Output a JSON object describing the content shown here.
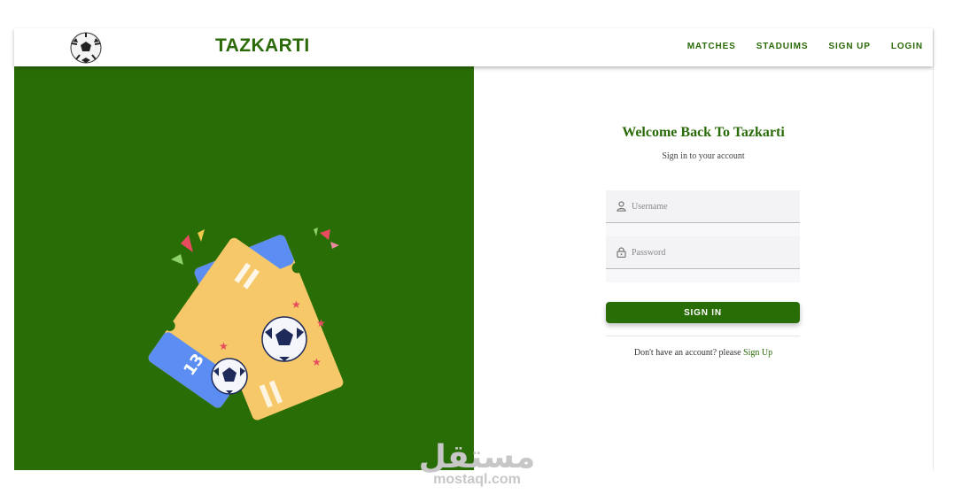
{
  "header": {
    "brand": "TAZKARTI",
    "logo_icon": "soccer-ball-icon",
    "nav": [
      {
        "label": "MATCHES"
      },
      {
        "label": "STADUIMS"
      },
      {
        "label": "SIGN UP"
      },
      {
        "label": "LOGIN"
      }
    ]
  },
  "hero": {
    "ticket_front_number": "13",
    "ticket_back_number": "12",
    "background_color": "#296d06"
  },
  "login": {
    "title": "Welcome Back To Tazkarti",
    "subtitle": "Sign in to your account",
    "username_placeholder": "Username",
    "username_value": "",
    "password_placeholder": "Password",
    "password_value": "",
    "submit_label": "SIGN IN",
    "signup_prompt": "Don't have an account? please",
    "signup_link": "Sign Up"
  },
  "watermark": {
    "arabic": "مستقل",
    "latin": "mostaql.com"
  },
  "colors": {
    "accent": "#2a6a08",
    "hero_bg": "#296d06",
    "ticket_yellow": "#f6c86a",
    "ticket_blue": "#5b8df2"
  }
}
